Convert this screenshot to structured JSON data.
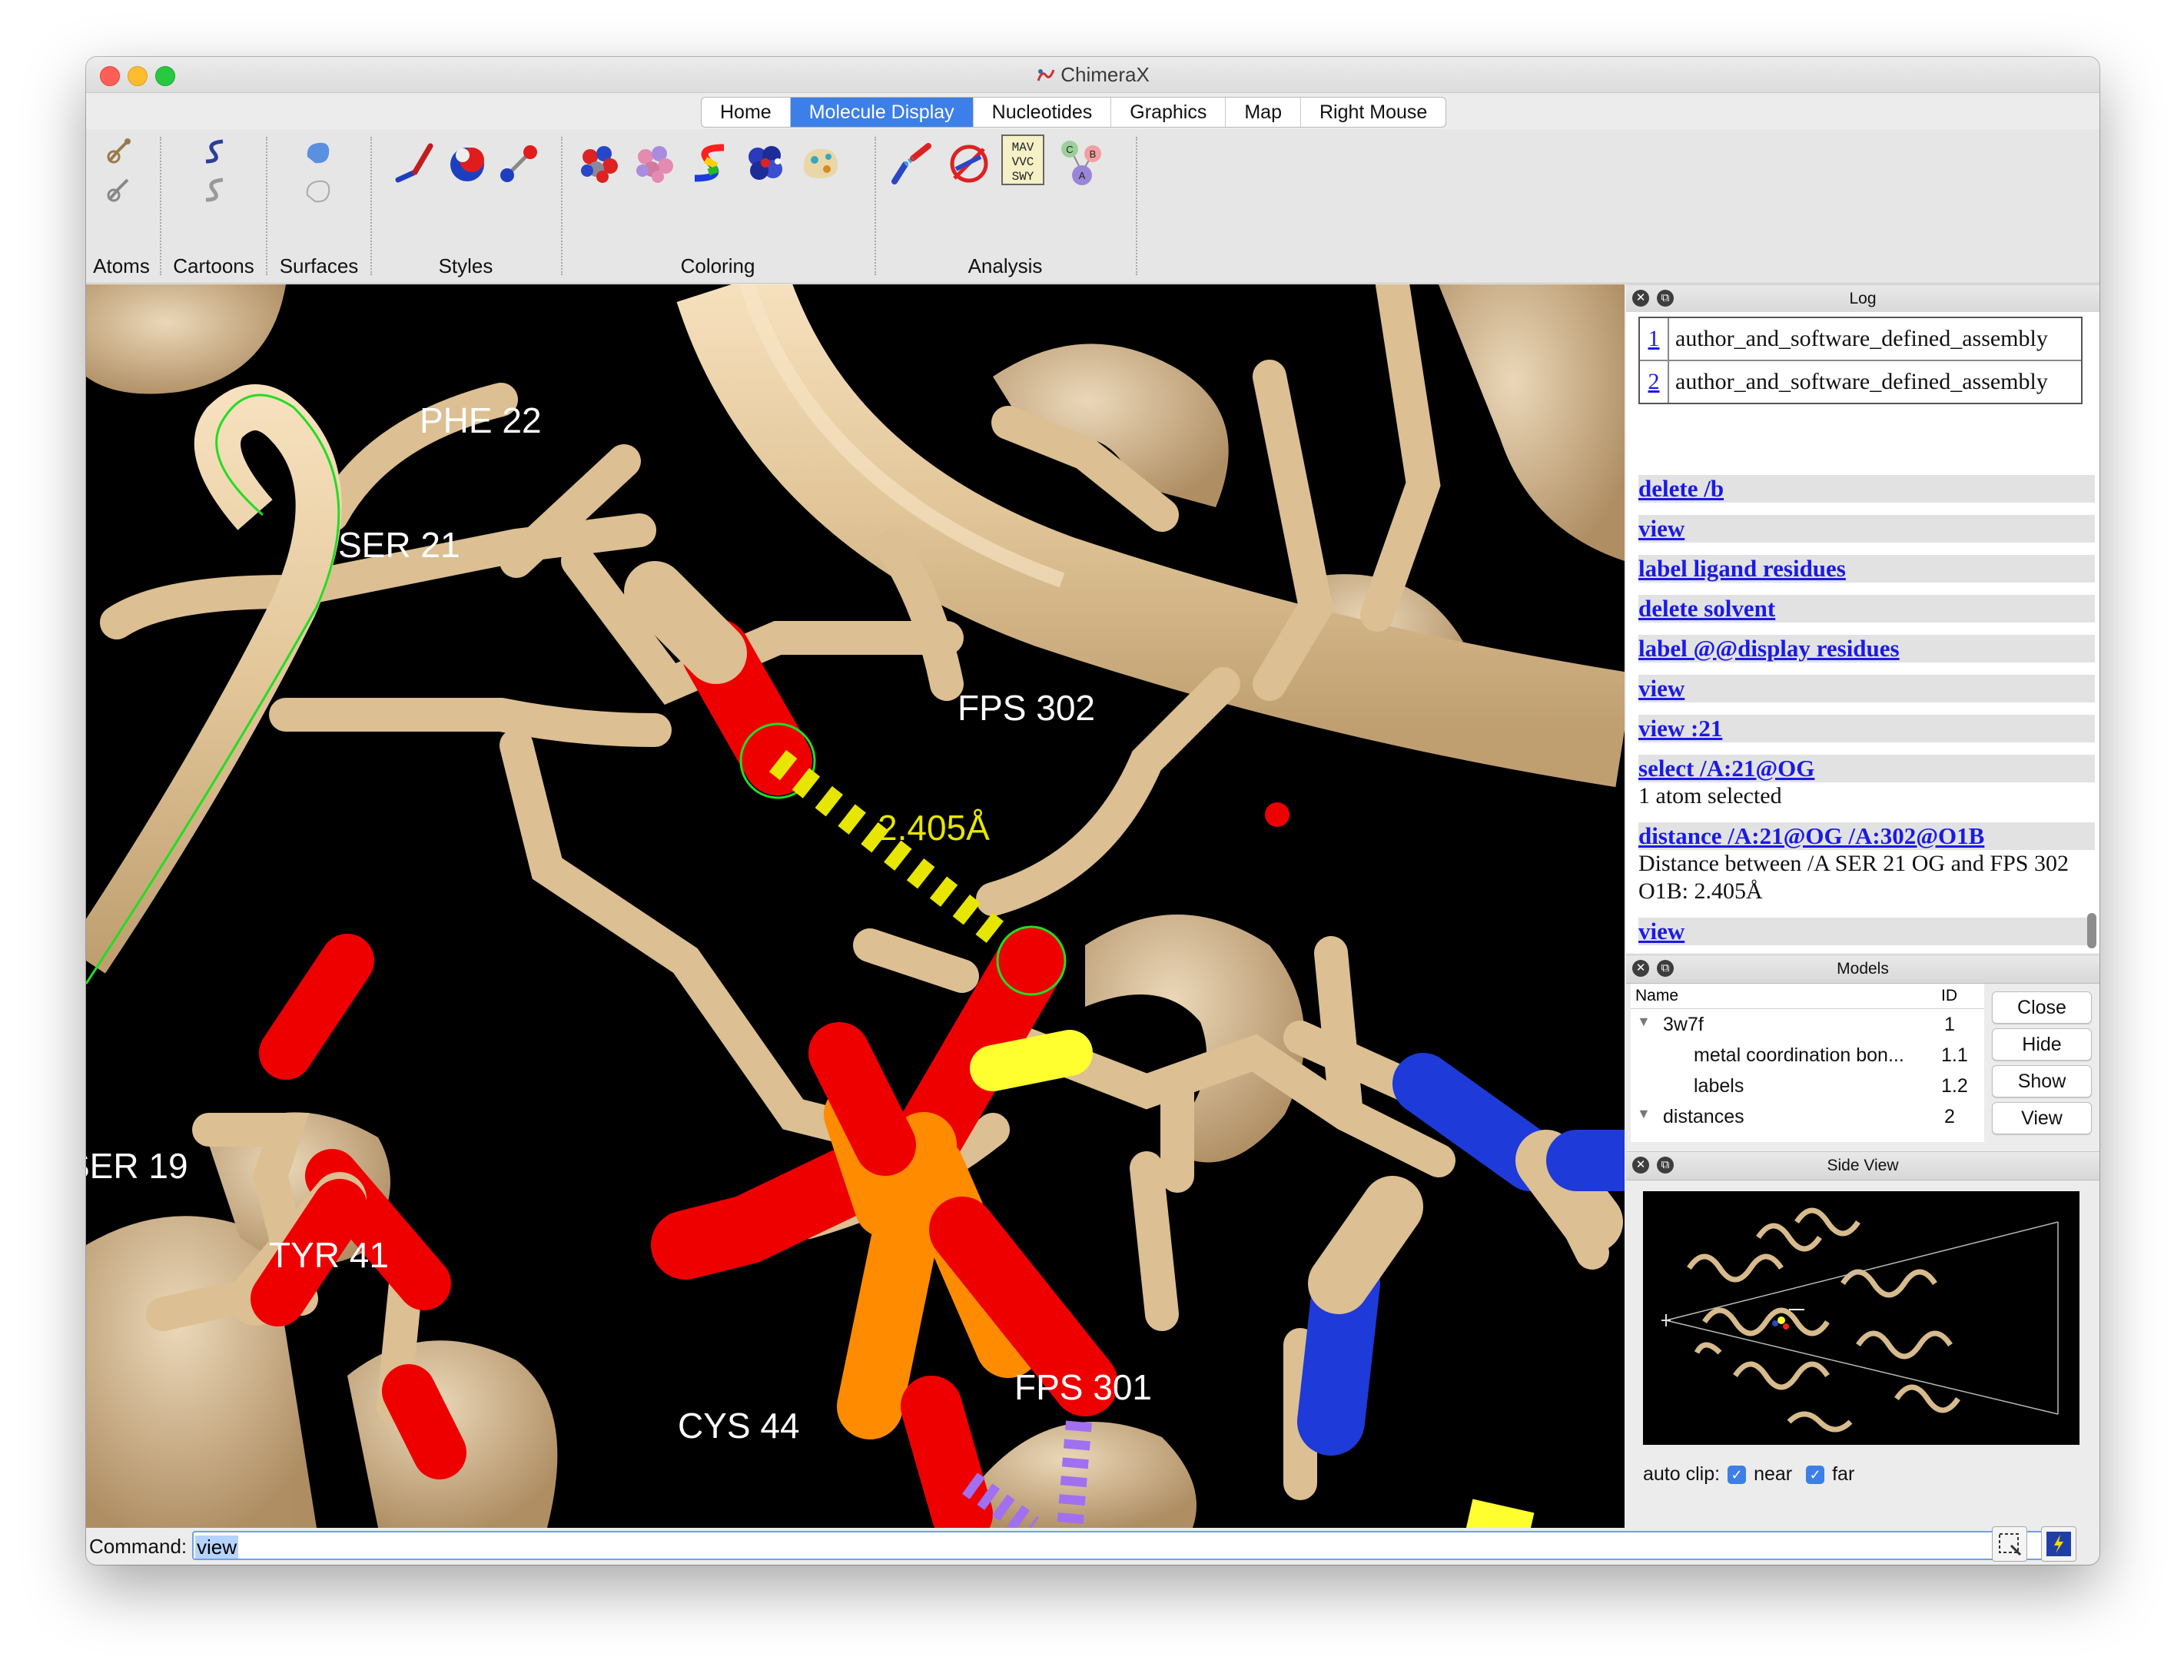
{
  "window": {
    "title": "ChimeraX"
  },
  "tabs": [
    {
      "label": "Home",
      "active": false
    },
    {
      "label": "Molecule Display",
      "active": true
    },
    {
      "label": "Nucleotides",
      "active": false
    },
    {
      "label": "Graphics",
      "active": false
    },
    {
      "label": "Map",
      "active": false
    },
    {
      "label": "Right Mouse",
      "active": false
    }
  ],
  "toolbar": {
    "groups": [
      "Atoms",
      "Cartoons",
      "Surfaces",
      "Styles",
      "Coloring",
      "Analysis"
    ],
    "sequence_icon_text": "MAV VVC SWY",
    "chain_icon_letters": [
      "C",
      "B",
      "A"
    ]
  },
  "viewer": {
    "labels": {
      "phe22": "PHE 22",
      "ser21": "SER 21",
      "fps302": "FPS 302",
      "distance": "2.405Å",
      "ser19": "SER 19",
      "tyr41": "TYR 41",
      "cys44": "CYS 44",
      "fps301": "FPS 301"
    },
    "colors": {
      "ribbon": "#e6c9a0",
      "oxygen": "#ff0d0d",
      "phosphorus": "#ff8c00",
      "nitrogen": "#2040ff",
      "sulfur": "#ffff30",
      "distance": "#e6e600",
      "selection": "#22dd22",
      "metal_bond": "#a070f0"
    }
  },
  "log": {
    "title": "Log",
    "assembly_rows": [
      {
        "num": "1",
        "text": "author_and_software_defined_assembly"
      },
      {
        "num": "2",
        "text": "author_and_software_defined_assembly"
      }
    ],
    "commands": [
      {
        "cmd": "delete /b"
      },
      {
        "cmd": "view"
      },
      {
        "cmd": "label ligand residues"
      },
      {
        "cmd": "delete solvent"
      },
      {
        "cmd": "label @@display residues"
      },
      {
        "cmd": "view"
      },
      {
        "cmd": "view :21"
      },
      {
        "cmd": "select /A:21@OG",
        "output": "1 atom selected"
      },
      {
        "cmd": "distance /A:21@OG /A:302@O1B",
        "output": "Distance between /A SER 21 OG and FPS 302 O1B: 2.405Å"
      },
      {
        "cmd": "view"
      }
    ]
  },
  "models": {
    "title": "Models",
    "col_name": "Name",
    "col_id": "ID",
    "rows": [
      {
        "name": "3w7f",
        "id": "1",
        "expanded": true
      },
      {
        "name": "metal coordination bon...",
        "id": "1.1"
      },
      {
        "name": "labels",
        "id": "1.2"
      },
      {
        "name": "distances",
        "id": "2",
        "expanded": true
      }
    ],
    "buttons": [
      "Close",
      "Hide",
      "Show",
      "View"
    ]
  },
  "side_view": {
    "title": "Side View",
    "auto_clip_label": "auto clip:",
    "near_label": "near",
    "far_label": "far",
    "near_checked": true,
    "far_checked": true
  },
  "command": {
    "label": "Command:",
    "value": "view"
  }
}
